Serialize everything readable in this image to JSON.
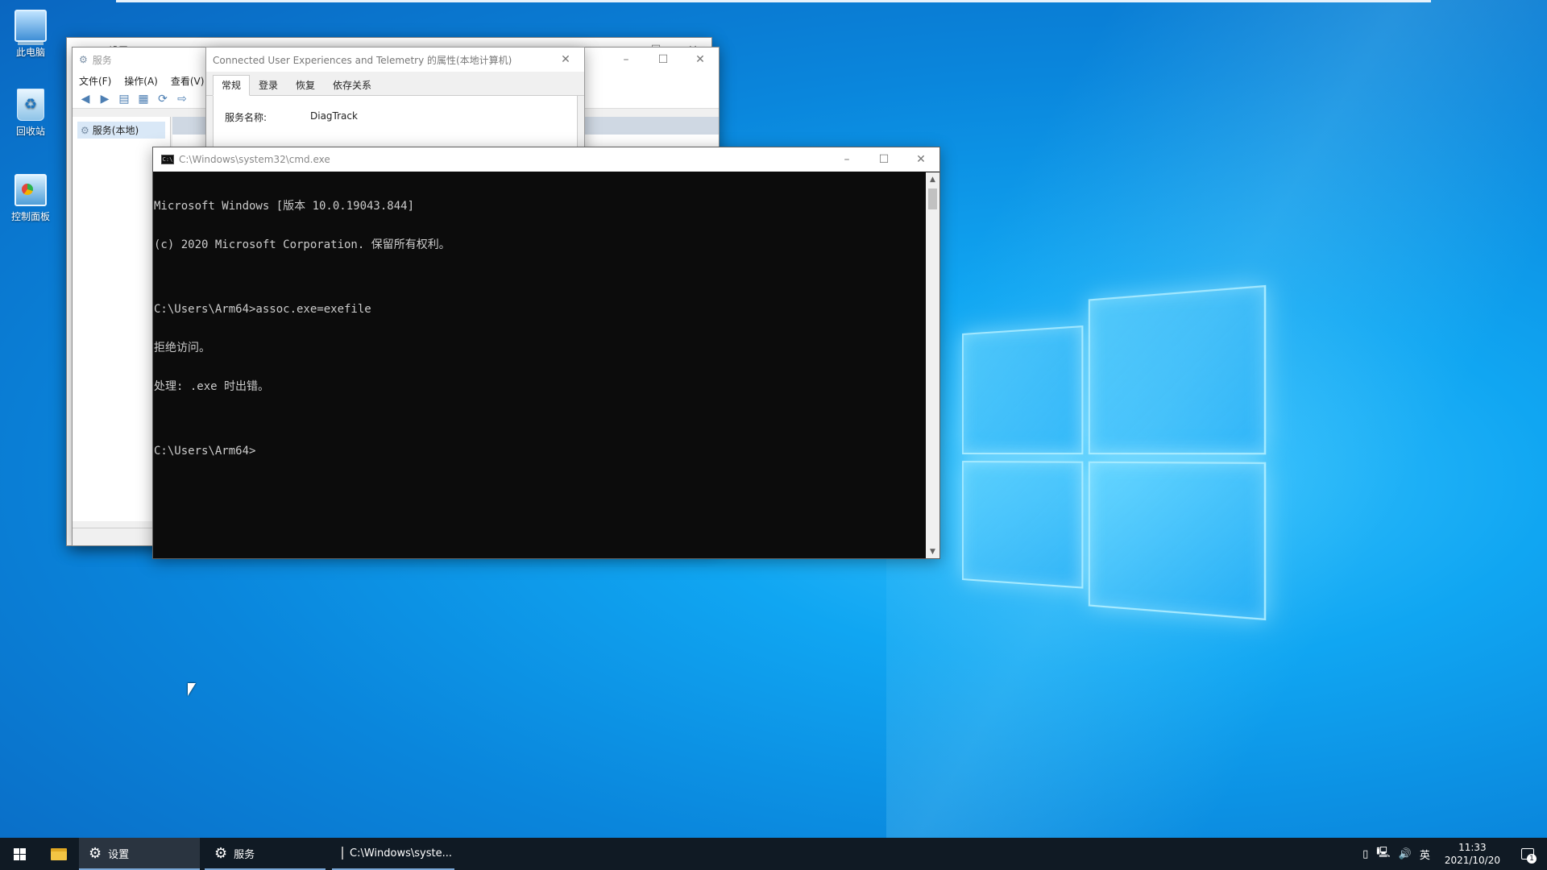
{
  "desktop": {
    "icons": [
      {
        "label": "此电脑"
      },
      {
        "label": "回收站"
      },
      {
        "label": "控制面板"
      }
    ]
  },
  "settings_window": {
    "title": "设置"
  },
  "services_window": {
    "title": "服务",
    "menu": [
      "文件(F)",
      "操作(A)",
      "查看(V)"
    ],
    "tree_item": "服务(本地)"
  },
  "properties_dialog": {
    "title": "Connected User Experiences and Telemetry 的属性(本地计算机)",
    "tabs": [
      "常规",
      "登录",
      "恢复",
      "依存关系"
    ],
    "service_name_label": "服务名称:",
    "service_name_value": "DiagTrack"
  },
  "cmd_window": {
    "title": "C:\\Windows\\system32\\cmd.exe",
    "lines": [
      "Microsoft Windows [版本 10.0.19043.844]",
      "(c) 2020 Microsoft Corporation. 保留所有权利。",
      "",
      "C:\\Users\\Arm64>assoc.exe=exefile",
      "拒绝访问。",
      "处理: .exe 时出错。",
      "",
      "C:\\Users\\Arm64>"
    ]
  },
  "taskbar": {
    "tasks": [
      {
        "label": "设置"
      },
      {
        "label": "服务"
      },
      {
        "label": "C:\\Windows\\syste..."
      }
    ],
    "ime": "英",
    "time": "11:33",
    "date": "2021/10/20",
    "notification_count": "1"
  }
}
